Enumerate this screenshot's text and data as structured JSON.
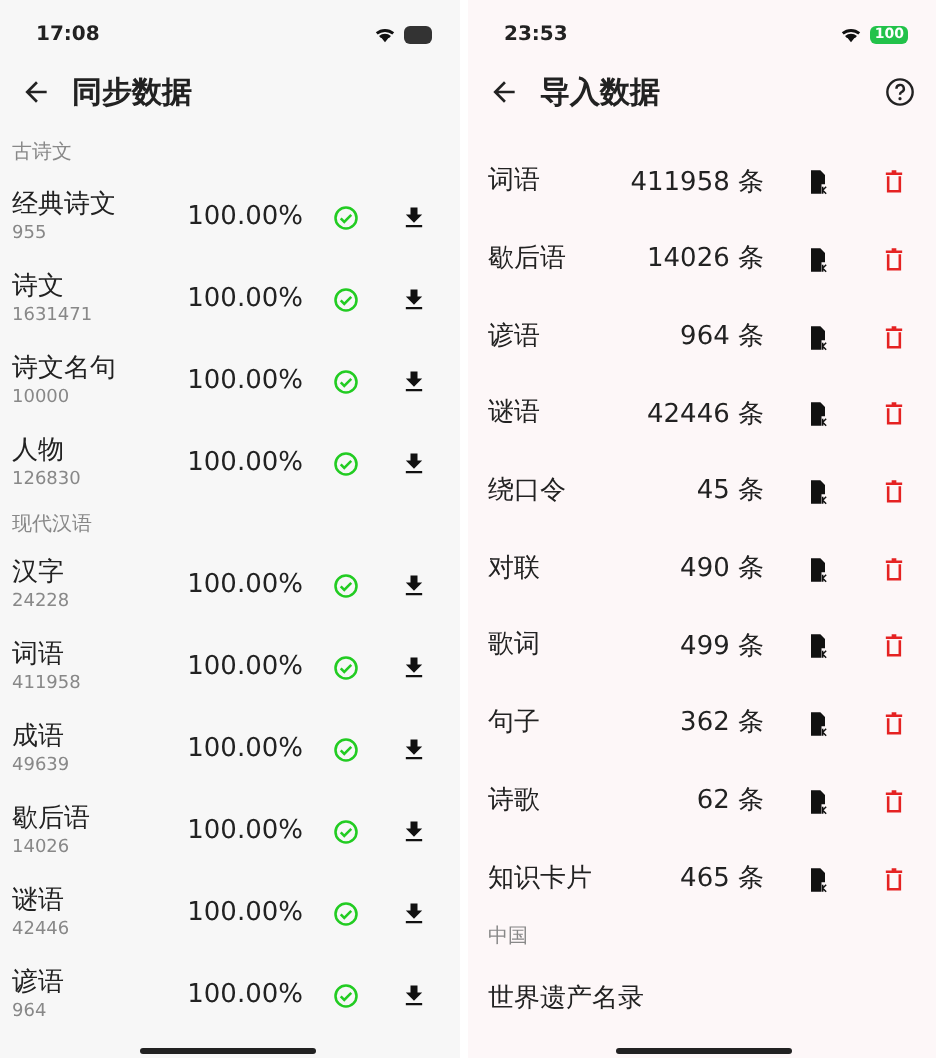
{
  "screens": [
    {
      "status_bar": {
        "time": "17:08"
      },
      "title": "同步数据",
      "sections": [
        {
          "heading": "古诗文",
          "items": [
            {
              "name": "经典诗文",
              "count": "955",
              "progress": "100.00%",
              "done": true
            },
            {
              "name": "诗文",
              "count": "1631471",
              "progress": "100.00%",
              "done": true
            },
            {
              "name": "诗文名句",
              "count": "10000",
              "progress": "100.00%",
              "done": true
            },
            {
              "name": "人物",
              "count": "126830",
              "progress": "100.00%",
              "done": true
            }
          ]
        },
        {
          "heading": "现代汉语",
          "items": [
            {
              "name": "汉字",
              "count": "24228",
              "progress": "100.00%",
              "done": true
            },
            {
              "name": "词语",
              "count": "411958",
              "progress": "100.00%",
              "done": true
            },
            {
              "name": "成语",
              "count": "49639",
              "progress": "100.00%",
              "done": true
            },
            {
              "name": "歇后语",
              "count": "14026",
              "progress": "100.00%",
              "done": true
            },
            {
              "name": "谜语",
              "count": "42446",
              "progress": "100.00%",
              "done": true
            },
            {
              "name": "谚语",
              "count": "964",
              "progress": "100.00%",
              "done": true
            }
          ]
        }
      ]
    },
    {
      "status_bar": {
        "time": "23:53",
        "battery": "100"
      },
      "title": "导入数据",
      "items": [
        {
          "name": "词语",
          "count": "411958 条"
        },
        {
          "name": "歇后语",
          "count": "14026 条"
        },
        {
          "name": "谚语",
          "count": "964 条"
        },
        {
          "name": "谜语",
          "count": "42446 条"
        },
        {
          "name": "绕口令",
          "count": "45 条"
        },
        {
          "name": "对联",
          "count": "490 条"
        },
        {
          "name": "歌词",
          "count": "499 条"
        },
        {
          "name": "句子",
          "count": "362 条"
        },
        {
          "name": "诗歌",
          "count": "62 条"
        },
        {
          "name": "知识卡片",
          "count": "465 条"
        }
      ],
      "section": {
        "heading": "中国",
        "items": [
          {
            "name": "世界遗产名录"
          }
        ]
      }
    }
  ]
}
